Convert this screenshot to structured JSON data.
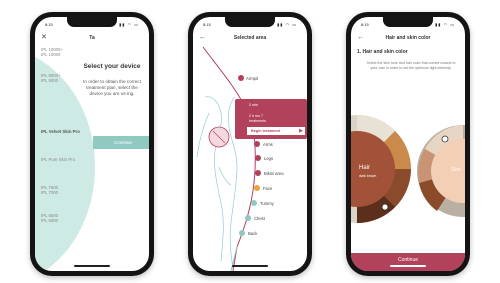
{
  "phone1": {
    "status_time": "8:15",
    "status_icons": "▮▮ ◠ ▭",
    "title": "Ta",
    "close_icon": "close-icon",
    "heading": "Select your device",
    "body": "In order to obtain the correct treatment plan, select the device you are us-ing.",
    "continue_label": "Continue",
    "devices": [
      "IPL 10000+\nIPL 10000",
      "IPL 9000+\nIPL 9000",
      "IPL Velvet Skin Pro",
      "IPL Pure Skin Pro",
      "IPL 7500\nIPL 7000",
      "IPL 6500\nIPL 6000"
    ],
    "accent": "#cdeae5"
  },
  "phone2": {
    "status_time": "8:15",
    "status_icons": "▮▮ ◠ ▭",
    "title": "Selected area",
    "back_icon": "arrow-left-icon",
    "zones": [
      {
        "label": "Armpit",
        "color": "#b2415b"
      },
      {
        "label": "Arms",
        "color": "#b2415b"
      },
      {
        "label": "Legs",
        "color": "#b2415b"
      },
      {
        "label": "Bikini area",
        "color": "#b2415b"
      },
      {
        "label": "Face",
        "color": "#e8a53a"
      },
      {
        "label": "Tummy",
        "color": "#8fc9bf"
      },
      {
        "label": "Chest",
        "color": "#8fc9bf"
      },
      {
        "label": "Back",
        "color": "#8fc9bf"
      }
    ],
    "popup": {
      "line1": "2 min",
      "line2": "2 h mo 7\ntreatments",
      "button": "Begin treatment",
      "arrow": "▶"
    },
    "accent": "#b2415b"
  },
  "phone3": {
    "status_time": "8:15",
    "status_icons": "▮▮ ◠ ▭",
    "title": "Hair and skin color",
    "back_icon": "arrow-left-icon",
    "subtitle": "1.  Hair and skin color",
    "description": "Select the skin tone and hair color that comes closest to your own in order to set the optimum light intensity.",
    "wheel_hair_label": "Hair",
    "wheel_hair_sub": "dark brown",
    "wheel_skin_label": "Skin",
    "continue_label": "Continue",
    "accent": "#b2415b"
  }
}
